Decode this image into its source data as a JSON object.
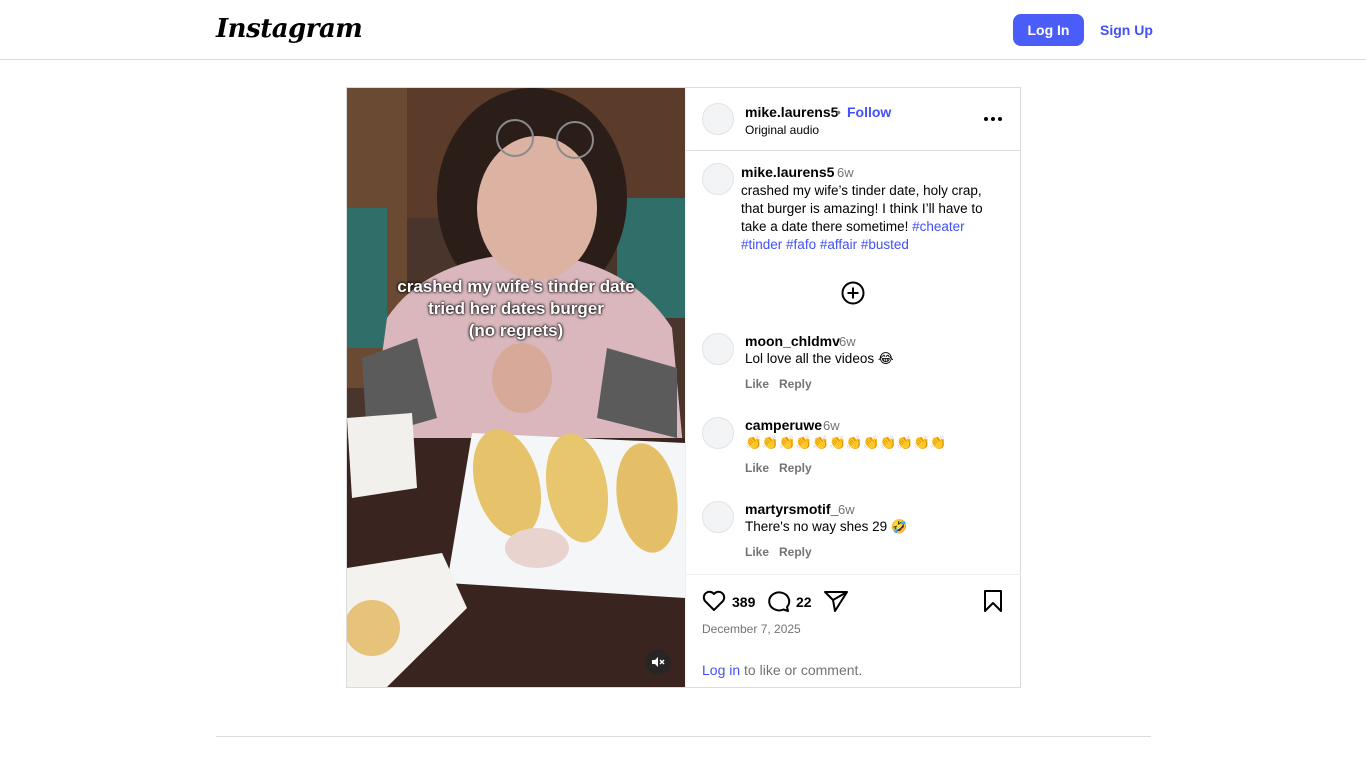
{
  "nav": {
    "logo": "Instagram",
    "login_label": "Log In",
    "signup_label": "Sign Up"
  },
  "media": {
    "overlay_lines": [
      "crashed my wife’s tinder date",
      "tried her dates burger",
      "(no regrets)"
    ],
    "mute_icon": "speaker-muted-icon"
  },
  "post": {
    "username": "mike.laurens5",
    "separator": "•",
    "follow_label": "Follow",
    "audio_label": "Original audio",
    "caption": {
      "username": "mike.laurens5",
      "time": "6w",
      "text": "crashed my wife’s tinder date, holy crap, that burger is amazing! I think I’ll have to take a date there sometime! ",
      "hashtags": [
        "#cheater",
        "#tinder",
        "#fafo",
        "#affair",
        "#busted"
      ]
    },
    "comments": [
      {
        "username": "moon_chldmv",
        "time": "6w",
        "text": "Lol love all the videos 😂",
        "like_label": "Like",
        "reply_label": "Reply"
      },
      {
        "username": "camperuwe",
        "time": "6w",
        "text": "👏👏👏👏👏👏👏👏👏👏👏👏",
        "like_label": "Like",
        "reply_label": "Reply"
      },
      {
        "username": "martyrsmotif_",
        "time": "6w",
        "text": "There's no way shes 29 🤣",
        "like_label": "Like",
        "reply_label": "Reply"
      }
    ],
    "likes": "389",
    "comment_count": "22",
    "date": "December 7, 2025",
    "login_prompt": {
      "link": "Log in",
      "rest": " to like or comment."
    }
  },
  "colors": {
    "accent": "#4a5df9",
    "link": "#4150f7",
    "muted": "#737373",
    "border": "#dbdbdb"
  }
}
